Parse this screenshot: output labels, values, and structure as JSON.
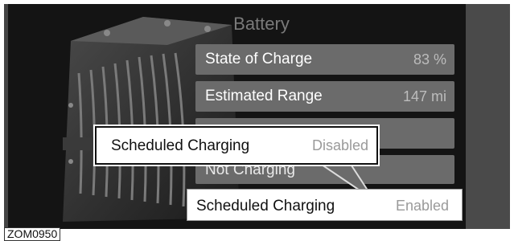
{
  "screen": {
    "title": "Battery",
    "rows": [
      {
        "label": "State of Charge",
        "value": "83 %"
      },
      {
        "label": "Estimated Range",
        "value": "147 mi"
      },
      {
        "label": "",
        "value": ""
      },
      {
        "label": "Not Charging",
        "value": ""
      }
    ]
  },
  "callout": {
    "label": "Scheduled Charging",
    "value": "Disabled"
  },
  "enabled_option": {
    "label": "Scheduled Charging",
    "value": "Enabled"
  },
  "figure_id": "ZOM0950",
  "colors": {
    "row_bg": "#6b6b6b",
    "display_bg": "#141414",
    "value_text": "#bcbcbc"
  },
  "icons": {
    "battery": "battery-illustration"
  }
}
